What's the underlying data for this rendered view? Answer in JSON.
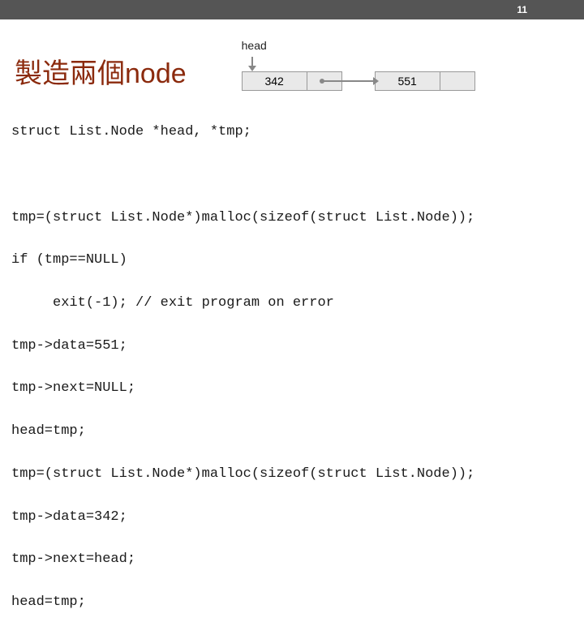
{
  "page_number": "11",
  "title": "製造兩個node",
  "diagram": {
    "pointer_label": "head",
    "node1_value": "342",
    "node2_value": "551"
  },
  "code": {
    "l0": "struct List.Node *head, *tmp;",
    "l1": "",
    "l2": "tmp=(struct List.Node*)malloc(sizeof(struct List.Node));",
    "l3": "if (tmp==NULL)",
    "l4": "     exit(-1); // exit program on error",
    "l5": "tmp->data=551;",
    "l6": "tmp->next=NULL;",
    "l7": "head=tmp;",
    "l8": "tmp=(struct List.Node*)malloc(sizeof(struct List.Node));",
    "l9": "tmp->data=342;",
    "l10": "tmp->next=head;",
    "l11": "head=tmp;"
  }
}
